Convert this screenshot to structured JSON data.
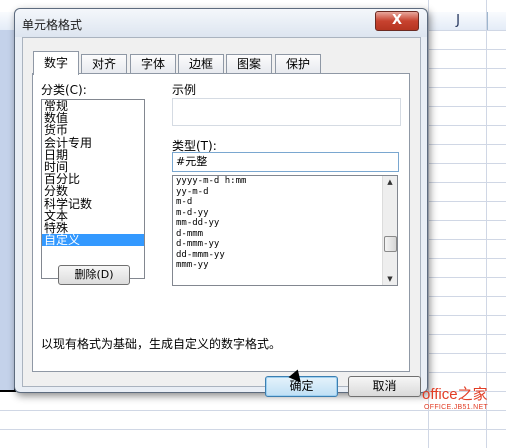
{
  "dialog": {
    "title": "单元格格式",
    "close_glyph": "X"
  },
  "tabs": [
    {
      "label": "数字",
      "active": true
    },
    {
      "label": "对齐"
    },
    {
      "label": "字体"
    },
    {
      "label": "边框"
    },
    {
      "label": "图案"
    },
    {
      "label": "保护"
    }
  ],
  "category": {
    "label": "分类(C):",
    "items": [
      "常规",
      "数值",
      "货币",
      "会计专用",
      "日期",
      "时间",
      "百分比",
      "分数",
      "科学记数",
      "文本",
      "特殊",
      "自定义"
    ],
    "selected": "自定义"
  },
  "delete_button": "删除(D)",
  "sample": {
    "label": "示例"
  },
  "type": {
    "label": "类型(T):",
    "value": "#元整",
    "options": [
      "yyyy-m-d h:mm",
      "yy-m-d",
      "m-d",
      "m-d-yy",
      "mm-dd-yy",
      "d-mmm",
      "d-mmm-yy",
      "dd-mmm-yy",
      "mmm-yy"
    ]
  },
  "description": "以现有格式为基础，生成自定义的数字格式。",
  "buttons": {
    "ok": "确定",
    "cancel": "取消"
  },
  "sheet": {
    "column_letter": "J"
  },
  "watermark": {
    "main": "office之家",
    "sub": "OFFICE.JB51.NET"
  }
}
